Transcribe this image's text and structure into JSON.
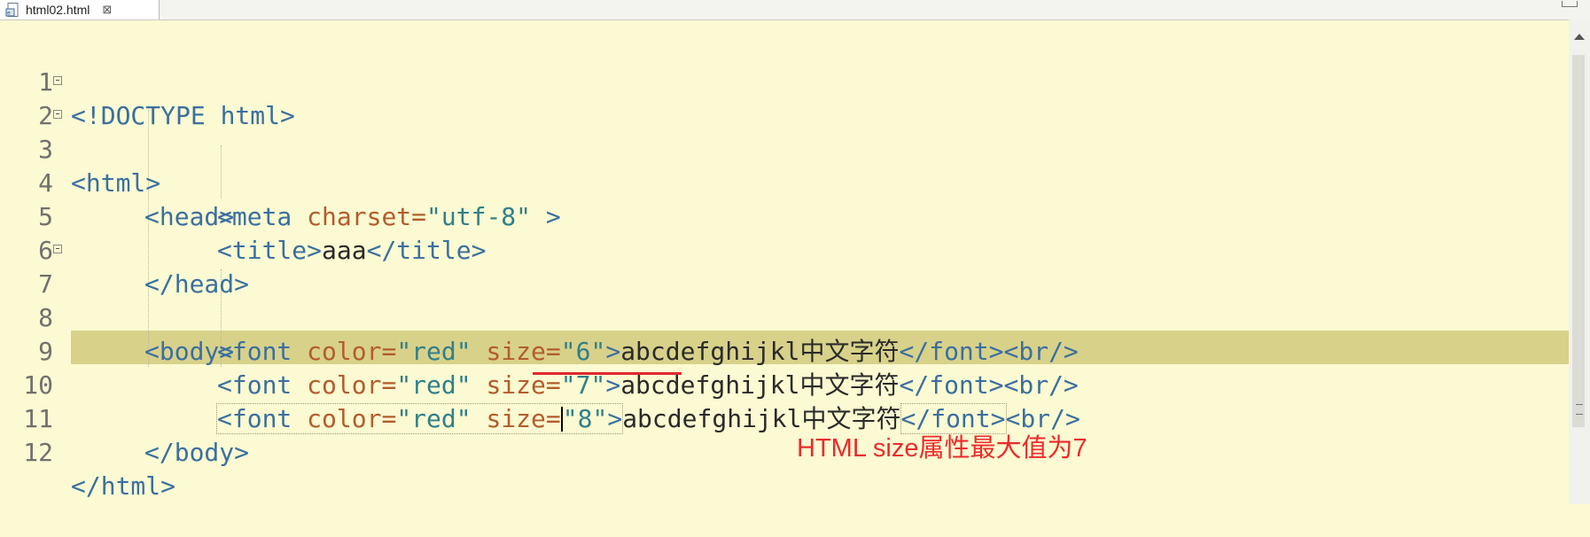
{
  "tab": {
    "filename": "html02.html",
    "close_glyph": "⊠"
  },
  "lines": [
    {
      "num": "1"
    },
    {
      "num": "2"
    },
    {
      "num": "3"
    },
    {
      "num": "4"
    },
    {
      "num": "5"
    },
    {
      "num": "6"
    },
    {
      "num": "7"
    },
    {
      "num": "8"
    },
    {
      "num": "9"
    },
    {
      "num": "10"
    },
    {
      "num": "11"
    },
    {
      "num": "12"
    }
  ],
  "code": {
    "l1": "<!DOCTYPE html>",
    "l2": "<html>",
    "l3": "<head>",
    "l4_tag_open": "<meta ",
    "l4_attr": "charset=",
    "l4_val": "\"utf-8\"",
    "l4_close": " >",
    "l5_open": "<title>",
    "l5_text": "aaa",
    "l5_close": "</title>",
    "l6": "</head>",
    "l7": "<body>",
    "l8_tag": "<font ",
    "l8_attr1": "color=",
    "l8_val1": "\"red\"",
    "l8_attr2": " size=",
    "l8_val2": "\"6\"",
    "l8_gt": ">",
    "l8_text": "abcdefghijkl中文字符",
    "l8_close": "</font><br/>",
    "l9_tag": "<font ",
    "l9_attr1": "color=",
    "l9_val1": "\"red\"",
    "l9_attr2": " size=",
    "l9_val2": "\"7\"",
    "l9_gt": ">",
    "l9_text": "abcdefghijkl中文字符",
    "l9_close": "</font><br/>",
    "l10_tag": "<font ",
    "l10_attr1": "color=",
    "l10_val1": "\"red\"",
    "l10_attr2": " size=",
    "l10_val2": "\"8\"",
    "l10_gt": ">",
    "l10_text": "abcdefghijkl中文字符",
    "l10_close1": "</font>",
    "l10_close2": "<br/>",
    "l11": "</body>",
    "l12": "</html>"
  },
  "annotation": {
    "text": "HTML size属性最大值为7",
    "color": "#ec2b2b"
  },
  "colors": {
    "editor_bg": "#fbfad2",
    "current_line": "#d8d18a",
    "tag": "#3a6fa0",
    "attr": "#b35c2c",
    "value": "#2f7f8a"
  }
}
